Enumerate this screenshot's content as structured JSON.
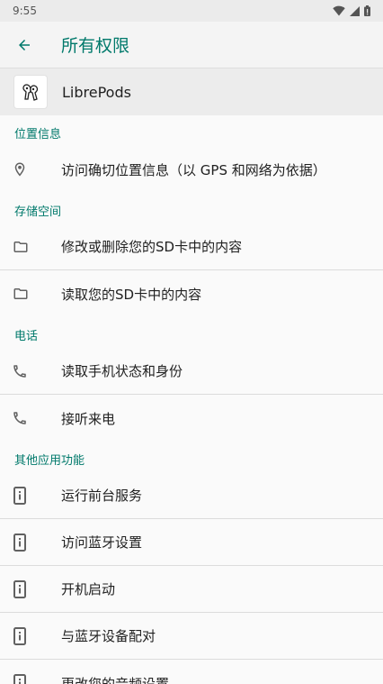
{
  "status_bar": {
    "time": "9:55"
  },
  "app_bar": {
    "title": "所有权限"
  },
  "app": {
    "name": "LibrePods"
  },
  "sections": [
    {
      "header": "位置信息",
      "items": [
        "访问确切位置信息（以 GPS 和网络为依据）"
      ]
    },
    {
      "header": "存储空间",
      "items": [
        "修改或删除您的SD卡中的内容",
        "读取您的SD卡中的内容"
      ]
    },
    {
      "header": "电话",
      "items": [
        "读取手机状态和身份",
        "接听来电"
      ]
    },
    {
      "header": "其他应用功能",
      "items": [
        "运行前台服务",
        "访问蓝牙设置",
        "开机启动",
        "与蓝牙设备配对",
        "更改您的音频设置"
      ]
    }
  ],
  "icons": {
    "back": "arrow-back-icon",
    "location": "location-pin-icon",
    "storage": "folder-icon",
    "phone": "phone-icon",
    "other": "device-info-icon"
  },
  "colors": {
    "accent": "#00796b",
    "divider": "#dcdcdc"
  }
}
